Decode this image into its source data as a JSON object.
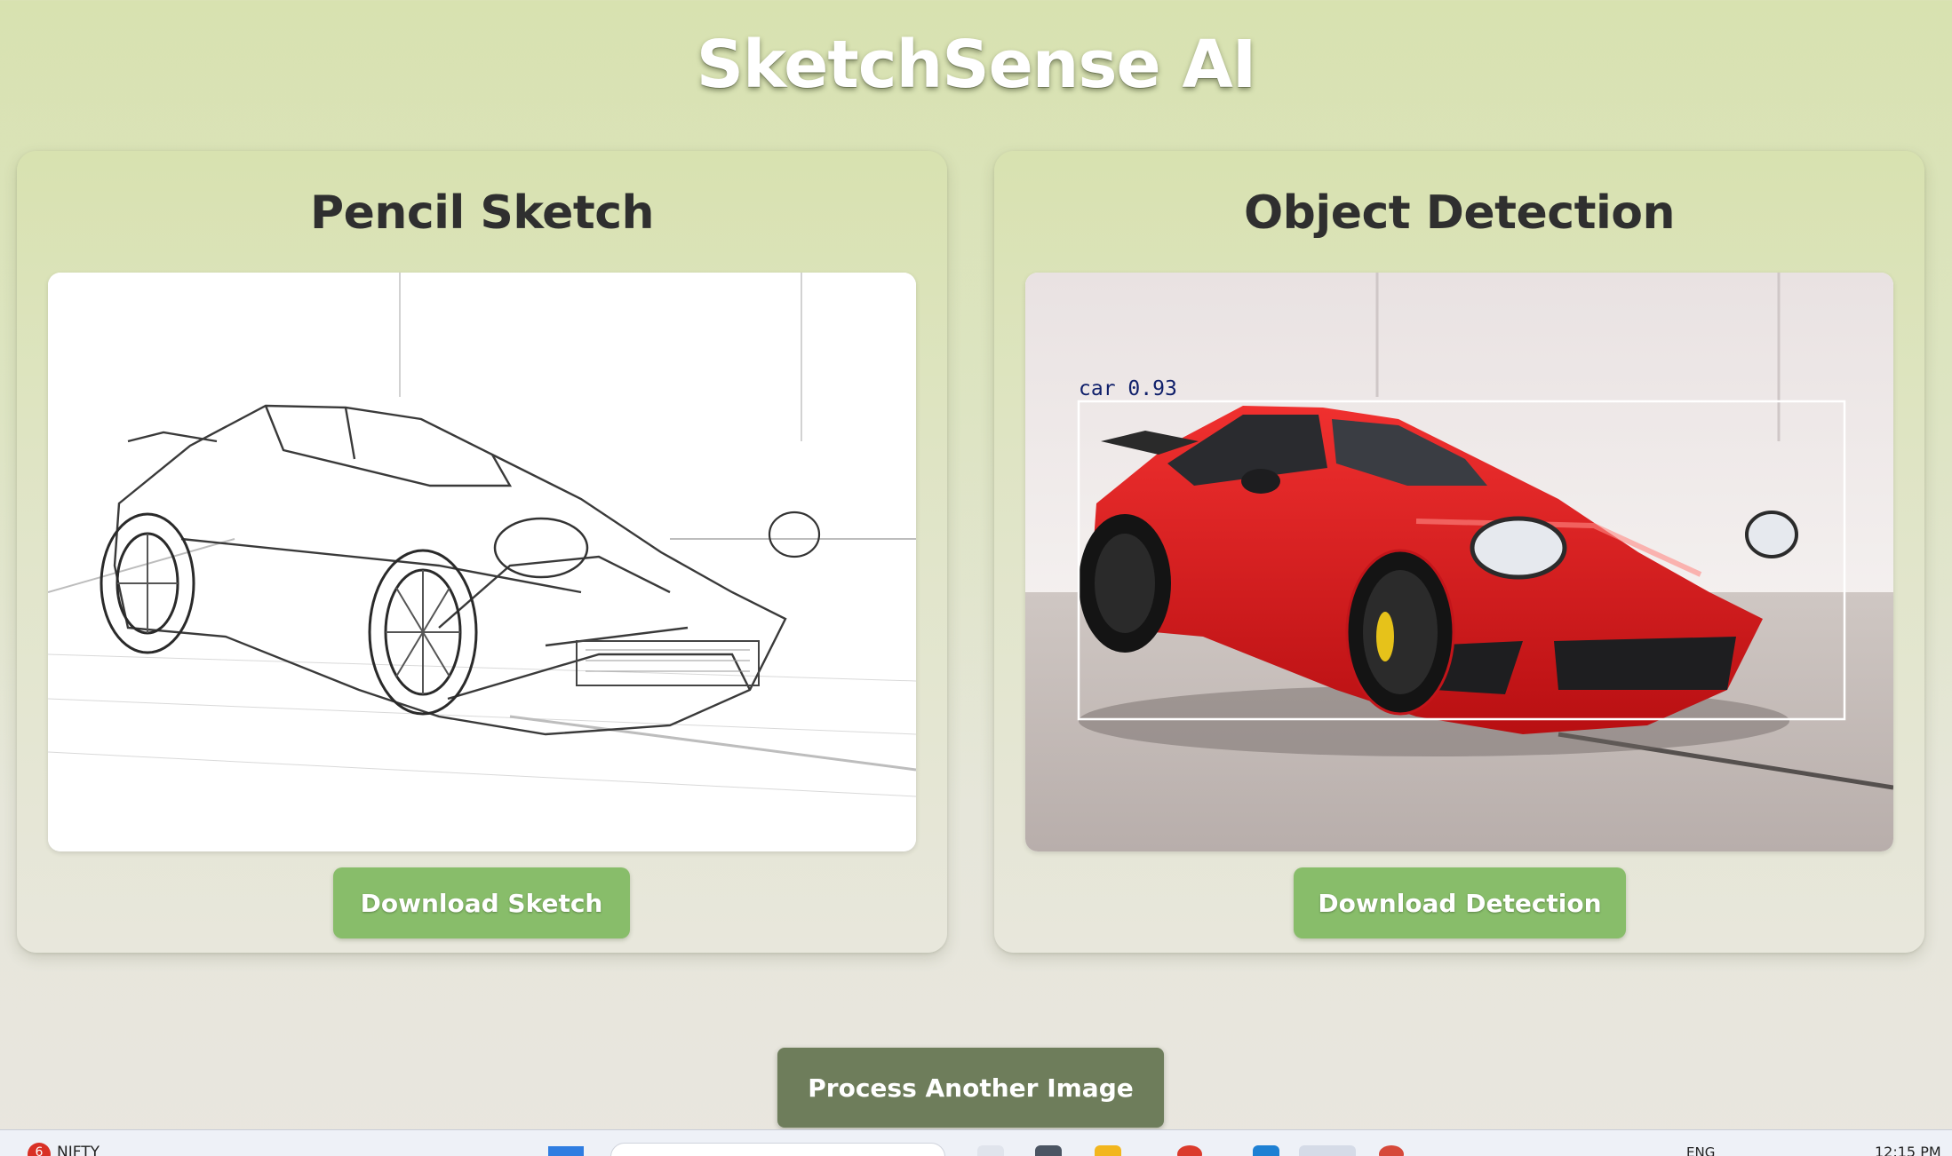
{
  "app": {
    "title": "SketchSense AI"
  },
  "sketch_panel": {
    "title": "Pencil Sketch",
    "download_label": "Download Sketch"
  },
  "detection_panel": {
    "title": "Object Detection",
    "download_label": "Download Detection",
    "detection_label": "car",
    "detection_score": "0.93"
  },
  "actions": {
    "process_another_label": "Process Another Image"
  },
  "taskbar": {
    "notification_count": "6",
    "ticker_label": "NIFTY",
    "language": "ENG",
    "clock": "12:15 PM"
  },
  "colors": {
    "button_green": "#88bd6a",
    "button_dark": "#6e7d5b",
    "car_red": "#d9191c"
  }
}
